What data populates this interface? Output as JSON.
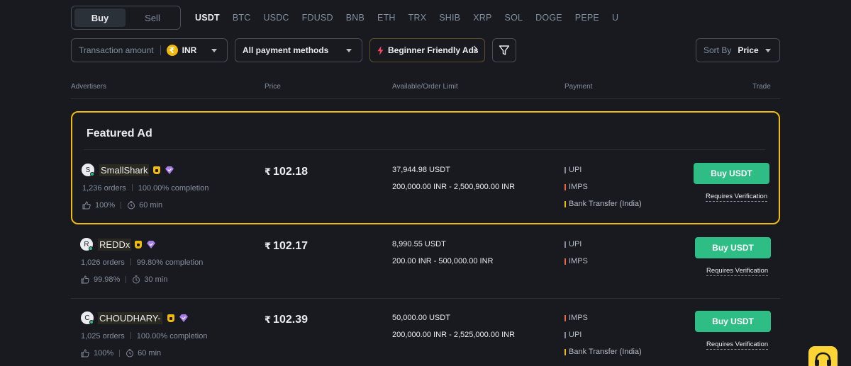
{
  "trade_toggle": {
    "buy": "Buy",
    "sell": "Sell"
  },
  "coins": [
    "USDT",
    "BTC",
    "USDC",
    "FDUSD",
    "BNB",
    "ETH",
    "TRX",
    "SHIB",
    "XRP",
    "SOL",
    "DOGE",
    "PEPE",
    "U"
  ],
  "active_coin": "USDT",
  "filters": {
    "amount_label": "Transaction amount",
    "currency": "INR",
    "currency_symbol": "₹",
    "payment_methods": "All payment methods",
    "beginner_ads": "Beginner Friendly Ads",
    "sort_label": "Sort By",
    "sort_value": "Price"
  },
  "headers": {
    "advertisers": "Advertisers",
    "price": "Price",
    "available": "Available/Order Limit",
    "payment": "Payment",
    "trade": "Trade"
  },
  "featured_title": "Featured Ad",
  "ads": [
    {
      "initial": "S",
      "name": "SmallShark",
      "orders": "1,236 orders",
      "completion": "100.00% completion",
      "like": "100%",
      "time": "60 min",
      "currency_symbol": "₹",
      "price": "102.18",
      "available": "37,944.98 USDT",
      "limit": "200,000.00 INR - 2,500,900.00 INR",
      "payments": [
        {
          "label": "UPI",
          "color": "#848e9c"
        },
        {
          "label": "IMPS",
          "color": "#f0663a"
        },
        {
          "label": "Bank Transfer (India)",
          "color": "#f0b90b"
        }
      ],
      "button": "Buy USDT",
      "requirement": "Requires Verification"
    },
    {
      "initial": "R",
      "name": "REDDx",
      "orders": "1,026 orders",
      "completion": "99.80% completion",
      "like": "99.98%",
      "time": "30 min",
      "currency_symbol": "₹",
      "price": "102.17",
      "available": "8,990.55 USDT",
      "limit": "200.00 INR - 500,000.00 INR",
      "payments": [
        {
          "label": "UPI",
          "color": "#848e9c"
        },
        {
          "label": "IMPS",
          "color": "#f0663a"
        }
      ],
      "button": "Buy USDT",
      "requirement": "Requires Verification"
    },
    {
      "initial": "C",
      "name": "CHOUDHARY-",
      "orders": "1,025 orders",
      "completion": "100.00% completion",
      "like": "100%",
      "time": "60 min",
      "currency_symbol": "₹",
      "price": "102.39",
      "available": "50,000.00 USDT",
      "limit": "200,000.00 INR - 2,525,000.00 INR",
      "payments": [
        {
          "label": "IMPS",
          "color": "#f0663a"
        },
        {
          "label": "UPI",
          "color": "#848e9c"
        },
        {
          "label": "Bank Transfer (India)",
          "color": "#f0b90b"
        }
      ],
      "button": "Buy USDT",
      "requirement": "Requires Verification"
    }
  ],
  "colors": {
    "accent": "#f0b90b",
    "buy": "#2ebd85",
    "bg": "#181a20"
  }
}
